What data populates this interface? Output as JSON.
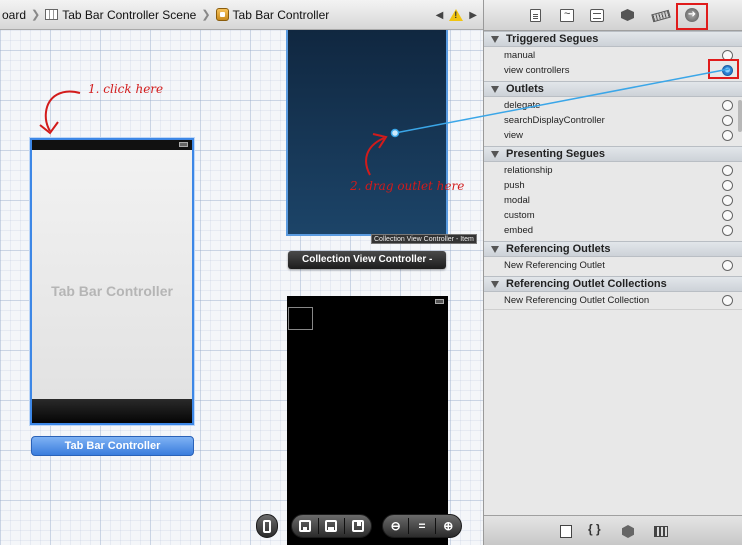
{
  "jumpbar": {
    "crumbs": [
      "oard",
      "Tab Bar Controller Scene",
      "Tab Bar Controller"
    ]
  },
  "canvas": {
    "tabbar_title": "Tab Bar Controller",
    "tabbar_label": "Tab Bar Controller",
    "cvc_label": "Collection View Controller -",
    "cvc_tooltip": "Collection View Controller - Item",
    "annotation_click": "1. click here",
    "annotation_drag": "2. drag outlet here"
  },
  "inspector": {
    "triggered_segues": {
      "title": "Triggered Segues",
      "items": [
        "manual",
        "view controllers"
      ]
    },
    "outlets": {
      "title": "Outlets",
      "items": [
        "delegate",
        "searchDisplayController",
        "view"
      ]
    },
    "presenting_segues": {
      "title": "Presenting Segues",
      "items": [
        "relationship",
        "push",
        "modal",
        "custom",
        "embed"
      ]
    },
    "referencing_outlets": {
      "title": "Referencing Outlets",
      "items": [
        "New Referencing Outlet"
      ]
    },
    "referencing_outlet_collections": {
      "title": "Referencing Outlet Collections",
      "items": [
        "New Referencing Outlet Collection"
      ]
    }
  },
  "colors": {
    "annotation": "#d21b1b",
    "selection": "#3d87e6",
    "connection_line": "#3aa6e8"
  }
}
